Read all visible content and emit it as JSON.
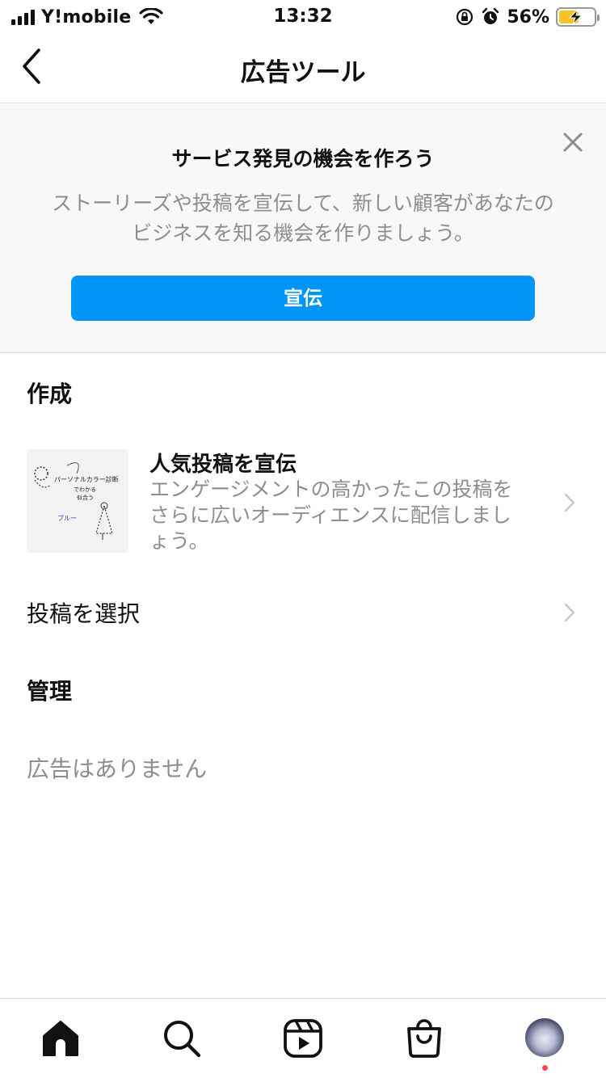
{
  "status_bar": {
    "carrier": "Y!mobile",
    "time": "13:32",
    "battery_percent": "56%",
    "battery_level": 0.56,
    "icons": [
      "signal-icon",
      "wifi-icon",
      "orientation-lock-icon",
      "alarm-icon",
      "battery-icon"
    ]
  },
  "nav": {
    "title": "広告ツール",
    "back_icon": "chevron-left-icon"
  },
  "promo": {
    "title": "サービス発見の機会を作ろう",
    "description": "ストーリーズや投稿を宣伝して、新しい顧客があなたのビジネスを知る機会を作りましょう。",
    "button_label": "宣伝",
    "close_icon": "close-icon",
    "button_color": "#0095f6"
  },
  "create": {
    "section_title": "作成",
    "boost_title": "人気投稿を宣伝",
    "boost_description": "エンゲージメントの高かったこの投稿をさらに広いオーディエンスに配信しましょう。",
    "thumbnail_text": [
      "パーソナルカラー診断",
      "でわかる",
      "似合う",
      "ブルー"
    ],
    "select_post_label": "投稿を選択"
  },
  "manage": {
    "section_title": "管理",
    "empty_text": "広告はありません"
  },
  "tab_bar": {
    "tabs": [
      "home-icon",
      "search-icon",
      "reels-icon",
      "shop-icon",
      "profile-avatar"
    ],
    "notification_color": "#ed4956"
  }
}
